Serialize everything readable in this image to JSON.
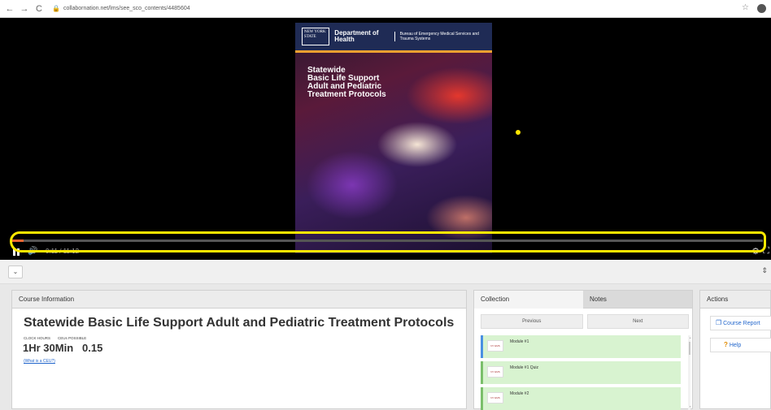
{
  "browser": {
    "url": "collabornation.net/lms/see_sco_contents/4485604"
  },
  "poster": {
    "ny_logo": "NEW YORK STATE",
    "department": "Department of Health",
    "bureau": "Bureau of Emergency Medical Services and Trauma Systems",
    "title_lines": [
      "Statewide",
      "Basic Life Support",
      "Adult and Pediatric",
      "Treatment Protocols"
    ]
  },
  "player": {
    "time": "0:11 / 11:12",
    "progress_fraction": 0.016
  },
  "course": {
    "panel_title": "Course Information",
    "title": "Statewide Basic Life Support Adult and Pediatric Treatment Protocols",
    "hours_label": "CLOCK HOURS",
    "ceus_label": "CEUs POSSIBLE",
    "hours_value": "1Hr 30Min",
    "ceus_value": "0.15",
    "ceu_link": "(What is a CEU?)"
  },
  "collection": {
    "tab_collection": "Collection",
    "tab_notes": "Notes",
    "previous": "Previous",
    "next": "Next",
    "modules": [
      {
        "name": "Module #1",
        "thumb": "NY EMS"
      },
      {
        "name": "Module #1 Quiz",
        "thumb": "NY EMS"
      },
      {
        "name": "Module #2",
        "thumb": "NY EMS"
      }
    ]
  },
  "actions": {
    "title": "Actions",
    "course_report": "Course Report",
    "help": "Help"
  },
  "colors": {
    "highlight": "#ffe800",
    "module_bg": "#d8f3d0",
    "link": "#2266cc"
  }
}
